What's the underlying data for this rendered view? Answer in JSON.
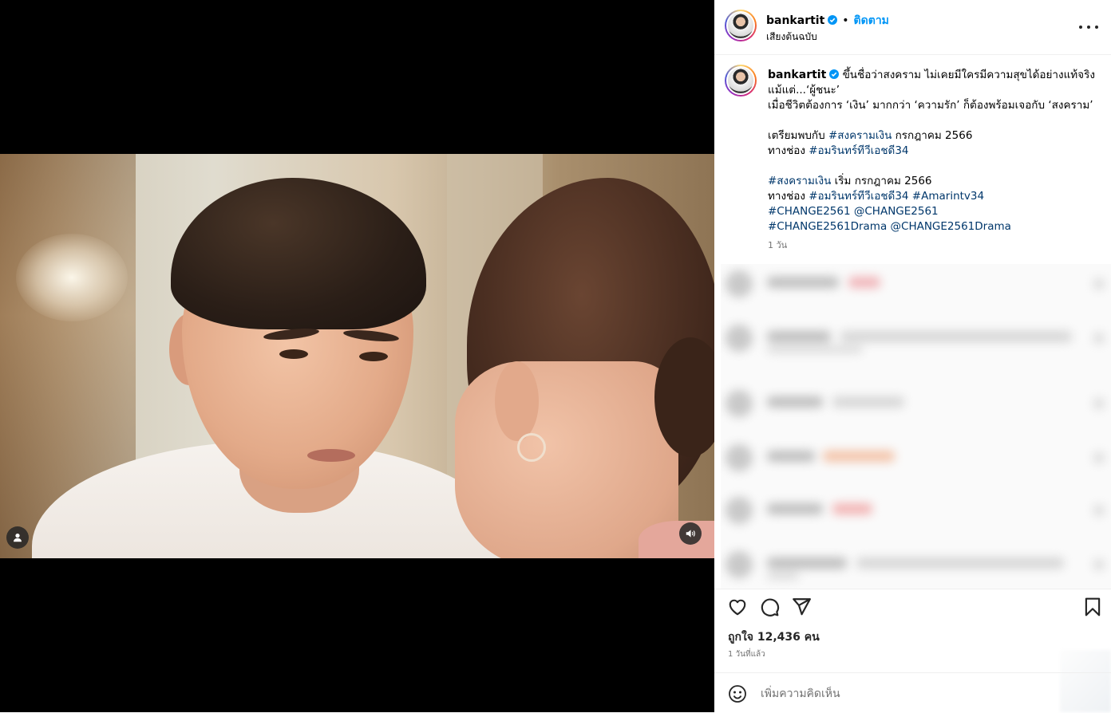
{
  "post": {
    "username": "bankartit",
    "follow_label": "ติดตาม",
    "audio_label": "เสียงต้นฉบับ",
    "caption_lines": [
      "ขึ้นชื่อว่าสงคราม ไม่เคยมีใครมีความสุขได้อย่างแท้จริง",
      "แม้แต่...‘ผู้ชนะ’",
      "เมื่อชีวิตต้องการ ‘เงิน’ มากกว่า ‘ความรัก’ ก็ต้องพร้อมเจอกับ ‘สงคราม’",
      "เตรียมพบกับ",
      "#สงครามเงิน",
      "กรกฎาคม 2566",
      "ทางช่อง",
      "#อมรินทร์ทีวีเอชดี34",
      "#สงครามเงิน",
      "เริ่ม กรกฎาคม 2566",
      "ทางช่อง",
      "#อมรินทร์ทีวีเอชดี34",
      "#Amarintv34",
      "#CHANGE2561",
      "@CHANGE2561",
      "#CHANGE2561Drama",
      "@CHANGE2561Drama"
    ],
    "caption_time": "1 วัน",
    "likes_label": "ถูกใจ 12,436 คน",
    "time_ago": "1 วันที่แล้ว",
    "comment_placeholder": "เพิ่มความคิดเห็น"
  },
  "colors": {
    "follow": "#0095f6",
    "hashtag": "#00376b",
    "verified": "#0095f6"
  },
  "icons": {
    "more": "more-options-icon",
    "like": "heart-icon",
    "comment": "comment-icon",
    "share": "share-icon",
    "save": "bookmark-icon",
    "emoji": "emoji-icon",
    "tags": "user-tag-icon",
    "audio": "speaker-icon"
  }
}
